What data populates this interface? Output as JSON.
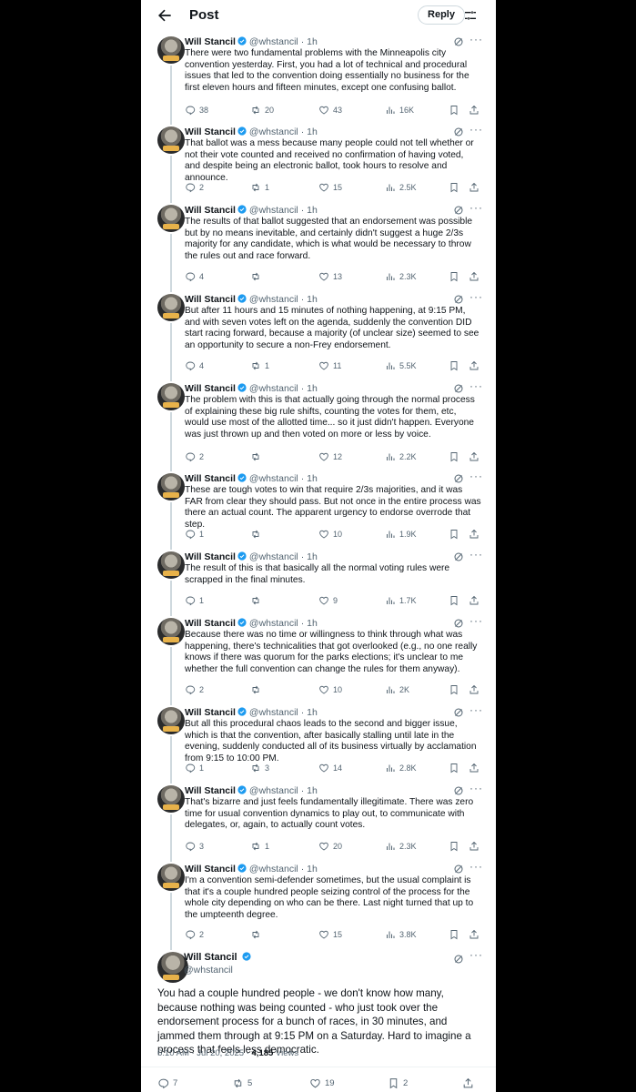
{
  "header": {
    "title": "Post",
    "reply_label": "Reply"
  },
  "author": {
    "name": "Will Stancil",
    "handle": "@whstancil",
    "time": "1h",
    "sep": "·"
  },
  "tweets": [
    {
      "text": "There were two fundamental problems with the Minneapolis city convention yesterday. First, you had a lot of technical and procedural issues that led to the convention doing essentially no business for the first eleven hours and fifteen minutes, except one confusing ballot.",
      "replies": "38",
      "reposts": "20",
      "likes": "43",
      "views": "16K"
    },
    {
      "text": "That ballot was a mess because many people could not tell whether or not their vote counted and received no confirmation of having voted, and despite being an electronic ballot, took hours to resolve and announce.",
      "replies": "2",
      "reposts": "1",
      "likes": "15",
      "views": "2.5K"
    },
    {
      "text": "The results of that ballot suggested that an endorsement was possible but by no means inevitable, and certainly didn't suggest a huge 2/3s majority for any candidate, which is what would be necessary to throw the rules out and race forward.",
      "replies": "4",
      "reposts": "",
      "likes": "13",
      "views": "2.3K"
    },
    {
      "text": "But after 11 hours and 15 minutes of nothing happening, at 9:15 PM, and with seven votes left on the agenda, suddenly the convention DID start racing forward, because a majority (of unclear size) seemed to see an opportunity to secure a non-Frey endorsement.",
      "replies": "4",
      "reposts": "1",
      "likes": "11",
      "views": "5.5K"
    },
    {
      "text": "The problem with this is that actually going through the normal process of explaining these big rule shifts, counting the votes for them, etc, would use most of the allotted time... so it just didn't happen. Everyone was just thrown up and then voted on more or less by voice.",
      "replies": "2",
      "reposts": "",
      "likes": "12",
      "views": "2.2K"
    },
    {
      "text": "These are tough votes to win that require 2/3s majorities, and it was FAR from clear they should pass. But not once in the entire process was there an actual count. The apparent urgency to endorse overrode that step.",
      "replies": "1",
      "reposts": "",
      "likes": "10",
      "views": "1.9K"
    },
    {
      "text": "The result of this is that basically all the normal voting rules were scrapped in the final minutes.",
      "replies": "1",
      "reposts": "",
      "likes": "9",
      "views": "1.7K"
    },
    {
      "text": "Because there was no time or willingness to think through what was happening, there's technicalities that got overlooked (e.g., no one really knows if there was quorum for the parks elections; it's unclear to me whether the full convention can change the rules for them anyway).",
      "replies": "2",
      "reposts": "",
      "likes": "10",
      "views": "2K"
    },
    {
      "text": "But all this procedural chaos leads to the second and bigger issue, which is that the convention, after basically stalling until late in the evening, suddenly conducted all of its business virtually by acclamation from 9:15 to 10:00 PM.",
      "replies": "1",
      "reposts": "3",
      "likes": "14",
      "views": "2.8K"
    },
    {
      "text": "That's bizarre and just feels fundamentally illegitimate. There was zero time for usual convention dynamics to play out, to communicate with delegates, or, again, to actually count votes.",
      "replies": "3",
      "reposts": "1",
      "likes": "20",
      "views": "2.3K"
    },
    {
      "text": "I'm a convention semi-defender sometimes, but the usual complaint is that it's a couple hundred people seizing control of the process for the whole city depending on who can be there. Last night turned that up to the umpteenth degree.",
      "replies": "2",
      "reposts": "",
      "likes": "15",
      "views": "3.8K"
    }
  ],
  "final": {
    "name": "Will Stancil",
    "handle": "@whstancil",
    "text": "You had a couple hundred people - we don't know how many, because nothing was being counted - who just took over the endorsement process for a bunch of races, in 30 minutes, and jammed them through at 9:15 PM on a Saturday. Hard to imagine a process that feels less democratic.",
    "timestamp": "6:10 AM · Jul 20, 2025 · ",
    "views_count": "4,185",
    "views_label": " Views",
    "replies": "7",
    "reposts": "5",
    "likes": "19",
    "bookmarks": "2"
  },
  "colors": {
    "accent": "#1d9bf0",
    "text": "#0f1419",
    "muted": "#536471",
    "border": "#cfd9de"
  },
  "icons": [
    "back-arrow-icon",
    "settings-icon",
    "verified-icon",
    "grok-icon",
    "more-icon",
    "reply-icon",
    "repost-icon",
    "like-icon",
    "views-icon",
    "bookmark-icon",
    "share-icon"
  ]
}
